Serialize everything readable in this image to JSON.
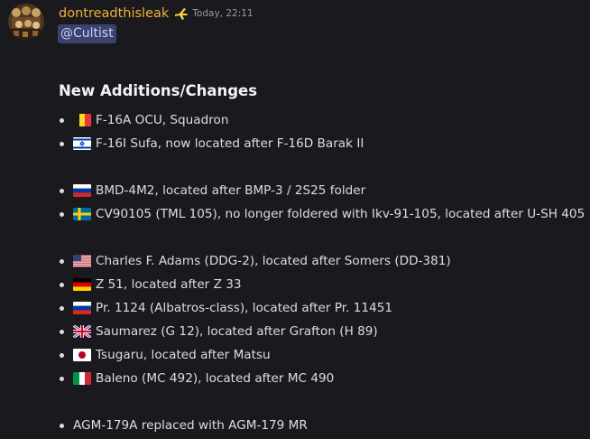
{
  "author": {
    "username": "dontreadthisleak",
    "timestamp": "Today, 22:11",
    "role_icon": "plane-icon"
  },
  "mention": "@Cultist",
  "section_title": "New Additions/Changes",
  "items": [
    {
      "flag": "belgium",
      "text": "F-16A OCU, Squadron"
    },
    {
      "flag": "israel",
      "text": "F-16I Sufa, now located after F-16D Barak II"
    },
    {
      "flag": "russia",
      "text": "BMD-4M2, located after BMP-3 / 2S25 folder"
    },
    {
      "flag": "sweden",
      "text": "CV90105 (TML 105), no longer foldered with Ikv-91-105, located after U-SH 405"
    },
    {
      "flag": "usa",
      "text": "Charles F. Adams (DDG-2), located after Somers (DD-381)"
    },
    {
      "flag": "germany",
      "text": "Z 51, located after Z 33"
    },
    {
      "flag": "russia",
      "text": "Pr. 1124 (Albatros-class), located after Pr. 11451"
    },
    {
      "flag": "uk",
      "text": "Saumarez (G 12), located after Grafton (H 89)"
    },
    {
      "flag": "japan",
      "text": "Tsugaru, located after Matsu"
    },
    {
      "flag": "italy",
      "text": "Baleno (MC 492), located after MC 490"
    },
    {
      "flag": "",
      "text": "AGM-179A replaced with AGM-179 MR"
    }
  ],
  "colors": {
    "background": "#1a1a1e",
    "username": "#f0b232",
    "mention_bg": "#3c4270",
    "mention_text": "#c9cdfb"
  }
}
